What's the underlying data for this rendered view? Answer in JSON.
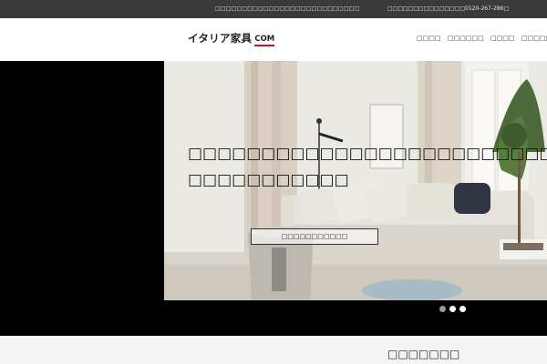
{
  "topbar": {
    "notice": "□□□□□□□□□□□□□□□□□□□□□□□□□□□",
    "phone": "□□□□□□□□□□□□□□□0120-267-286□"
  },
  "header": {
    "logo_text": "イタリア家具",
    "logo_suffix": "COM",
    "nav": [
      "□□□□",
      "□□□□□□",
      "□□□□",
      "□□□□□"
    ]
  },
  "hero": {
    "title_line1": "□□□□□□□□□□□□□□□□□□□□□□□□□□□□□",
    "title_line2": "□□□□□□□□□□□",
    "button_label": "□□□□□□□□□□□",
    "slide_count": 3,
    "active_slide": 2
  },
  "section": {
    "title": "□□□□□□□"
  }
}
